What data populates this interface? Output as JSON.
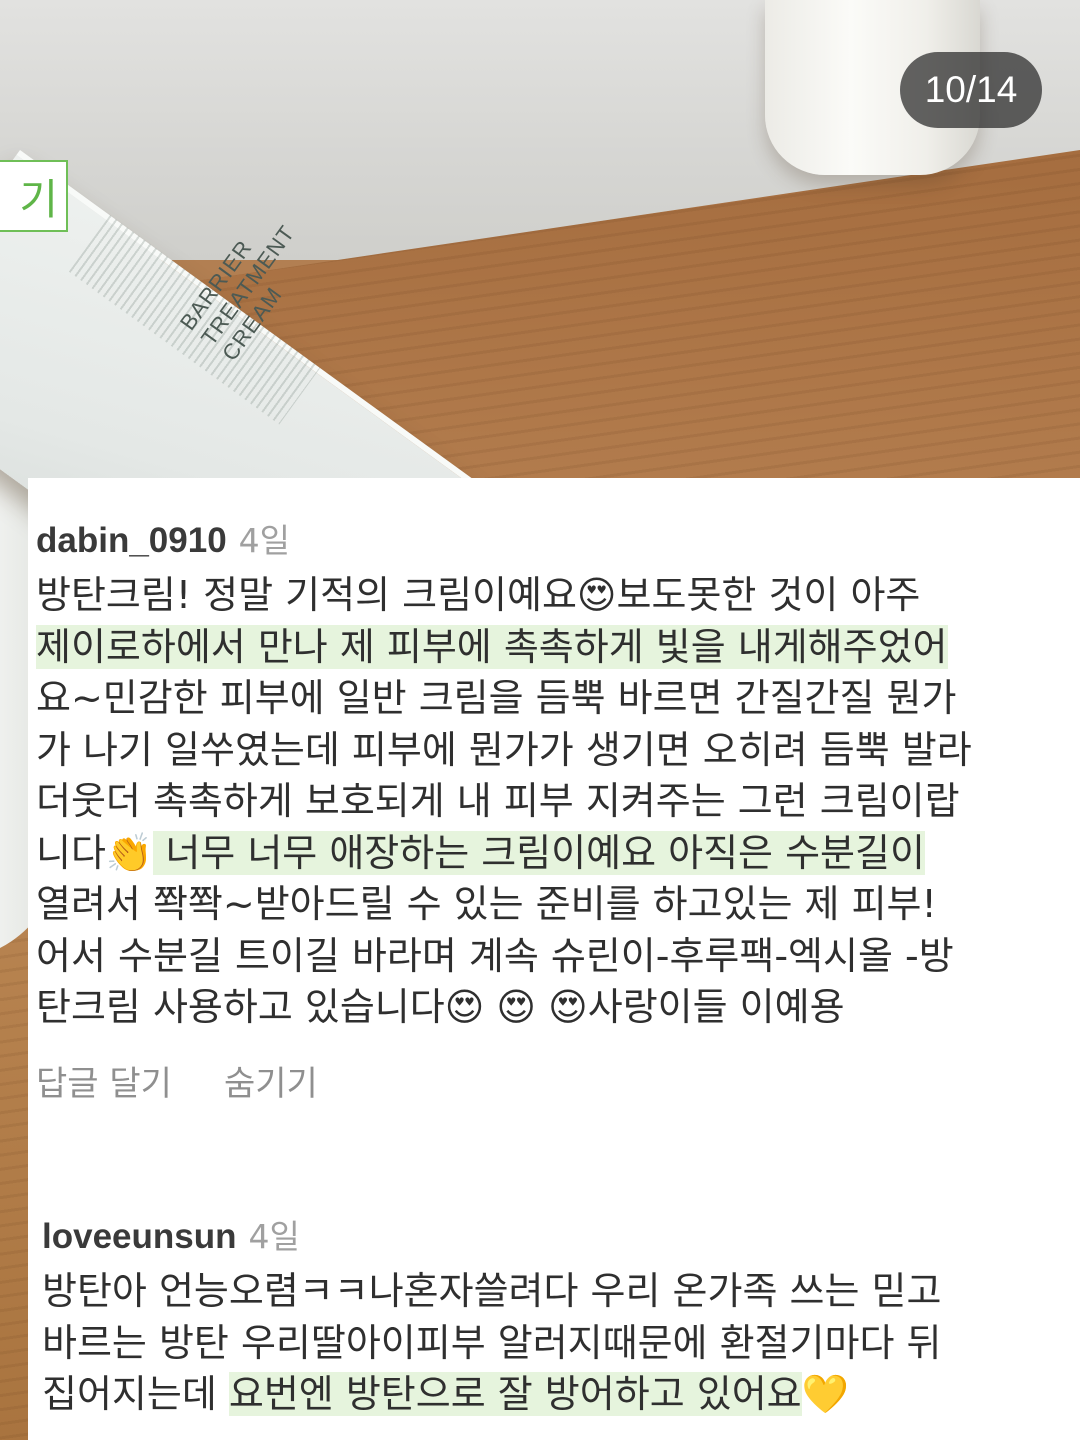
{
  "slide_counter": "10/14",
  "side_tab_text": "기",
  "product": {
    "box_text": "BARRIER TREATMENT CREAM"
  },
  "comments": [
    {
      "username": "dabin_0910",
      "time": "4일",
      "lines": [
        {
          "parts": [
            {
              "text": "방탄크림! 정말 기적의 크림이예요",
              "highlight": false
            },
            {
              "text": "😍",
              "emoji": true
            },
            {
              "text": "보도못한 것이 아주",
              "highlight": false
            }
          ]
        },
        {
          "parts": [
            {
              "text": "제이로하에서 만나 제 피부에 촉촉하게 빛을 내게해주었어",
              "highlight": true
            }
          ]
        },
        {
          "parts": [
            {
              "text": "요~민감한 피부에 일반 크림을 듬뿍 바르면 간질간질 뭔가",
              "highlight": false
            }
          ]
        },
        {
          "parts": [
            {
              "text": "가 나기 일쑤였는데 피부에 뭔가가 생기면 오히려 듬뿍 발라",
              "highlight": false
            }
          ]
        },
        {
          "parts": [
            {
              "text": "더웃더 촉촉하게 보호되게 내 피부 지켜주는 그런 크림이랍",
              "highlight": false
            }
          ]
        },
        {
          "parts": [
            {
              "text": "니다",
              "highlight": false
            },
            {
              "text": "👏",
              "emoji": true
            },
            {
              "text": " 너무 너무 애장하는 크림이예요 아직은 수분길이",
              "highlight": true
            }
          ]
        },
        {
          "parts": [
            {
              "text": "열려서 쫙쫙~받아드릴 수 있는 준비를 하고있는 제 피부!",
              "highlight": false
            }
          ]
        },
        {
          "parts": [
            {
              "text": "어서 수분길 트이길 바라며 계속 슈린이-후루팩-엑시올 -방",
              "highlight": false
            }
          ]
        },
        {
          "parts": [
            {
              "text": "탄크림 사용하고 있습니다",
              "highlight": false
            },
            {
              "text": "😍 😍 😍",
              "emoji": true
            },
            {
              "text": "사랑이들 이예용",
              "highlight": false
            }
          ]
        }
      ],
      "actions": [
        "답글 달기",
        "숨기기"
      ]
    },
    {
      "username": "loveeunsun",
      "time": "4일",
      "lines": [
        {
          "parts": [
            {
              "text": "방탄아 언능오렴ㅋㅋ나혼자쓸려다 우리  온가족 쓰는 믿고",
              "highlight": false
            }
          ]
        },
        {
          "parts": [
            {
              "text": "바르는 방탄 우리딸아이피부 알러지때문에 환절기마다 뒤",
              "highlight": false
            }
          ]
        },
        {
          "parts": [
            {
              "text": "집어지는데 ",
              "highlight": false
            },
            {
              "text": "요번엔 방탄으로 잘 방어하고 있어요",
              "highlight": true
            },
            {
              "text": "💛",
              "emoji": true
            }
          ]
        }
      ]
    }
  ]
}
